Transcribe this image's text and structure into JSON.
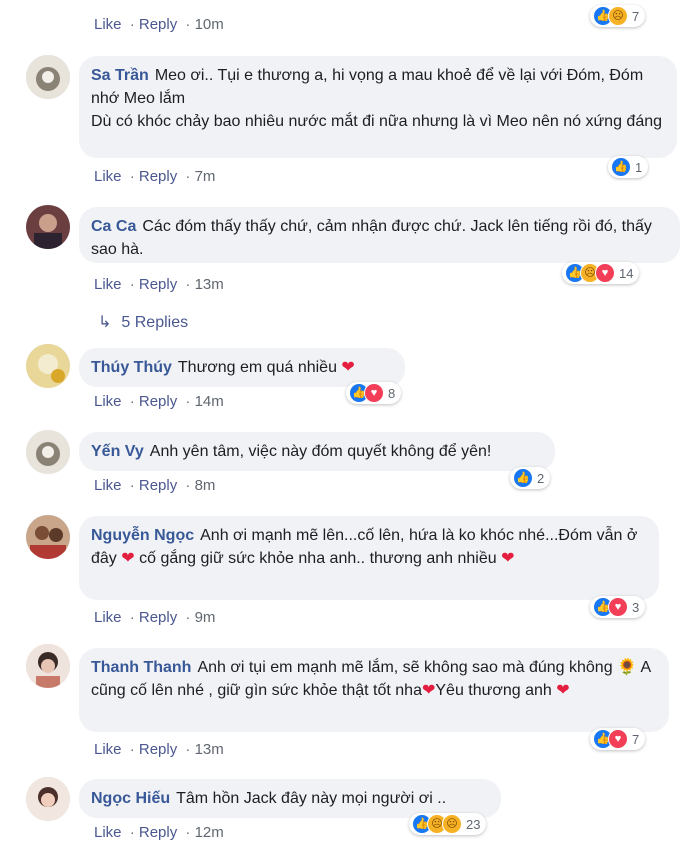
{
  "action_like": "Like",
  "action_reply": "Reply",
  "top": {
    "time": "10m",
    "reaction_count": "7"
  },
  "comments": [
    {
      "name": "Sa Trần",
      "text": "Meo ơi.. Tụi e thương a, hi vọng a mau khoẻ để về lại với Đóm, Đóm nhớ Meo lắm\nDù có khóc chảy bao nhiêu nước mắt đi nữa nhưng là vì Meo nên nó xứng đáng",
      "time": "7m",
      "reaction_count": "1"
    },
    {
      "name": "Ca Ca",
      "text": "Các đóm thấy thấy chứ, cảm nhận được chứ. Jack lên tiếng rồi đó, thấy sao hà.",
      "time": "13m",
      "reaction_count": "14"
    },
    {
      "name": "Thúy Thúy",
      "text": "Thương em quá nhiều",
      "time": "14m",
      "reaction_count": "8"
    },
    {
      "name": "Yến Vy",
      "text": "Anh yên tâm, việc này đóm quyết không để yên!",
      "time": "8m",
      "reaction_count": "2"
    },
    {
      "name": "Nguyễn Ngọc",
      "text": "Anh ơi mạnh mẽ lên...cố lên, hứa là ko khóc nhé...Đóm vẫn ở đây",
      "text2": "cố gắng giữ sức khỏe nha anh.. thương anh nhiều",
      "time": "9m",
      "reaction_count": "3"
    },
    {
      "name": "Thanh Thanh",
      "text": "Anh ơi tụi em mạnh mẽ lắm, sẽ không sao mà đúng không",
      "text2": "A cũng cố lên nhé , giữ gìn sức khỏe thật tốt nha",
      "text3": "Yêu thương anh",
      "time": "13m",
      "reaction_count": "7"
    },
    {
      "name": "Ngọc Hiếu",
      "text": "Tâm hồn Jack đây này mọi người ơi ..",
      "time": "12m",
      "reaction_count": "23"
    }
  ],
  "replies_label": "5 Replies",
  "icons": {
    "heart": "heart-emoji",
    "sunflower": "sunflower-emoji",
    "like": "like-icon",
    "sad": "sad-icon",
    "love": "love-icon",
    "reply_arrow": "reply-arrow-icon"
  },
  "colors": {
    "name": "#385898",
    "bubble": "#f0f2f5",
    "like": "#1877f2",
    "love": "#f33e58",
    "sad": "#f7b125"
  }
}
